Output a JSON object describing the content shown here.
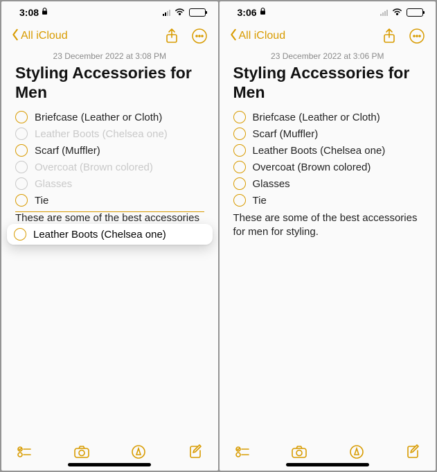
{
  "accent": "#d89b00",
  "left": {
    "status": {
      "time": "3:08",
      "lock": "🔒"
    },
    "nav": {
      "back_label": "All iCloud"
    },
    "date": "23 December 2022 at 3:08 PM",
    "title": "Styling Accessories for Men",
    "items": {
      "0": "Briefcase (Leather or Cloth)",
      "1": "Leather Boots (Chelsea one)",
      "2": "Scarf (Muffler)",
      "3": "Overcoat (Brown colored)",
      "4": "Glasses",
      "5": "Tie"
    },
    "drag_item": "Leather Boots (Chelsea one)",
    "body": "These are some of the best accessories for men for styling."
  },
  "right": {
    "status": {
      "time": "3:06",
      "lock": "🔒"
    },
    "nav": {
      "back_label": "All iCloud"
    },
    "date": "23 December 2022 at 3:06 PM",
    "title": "Styling Accessories for Men",
    "items": {
      "0": "Briefcase (Leather or Cloth)",
      "1": "Scarf (Muffler)",
      "2": "Leather Boots (Chelsea one)",
      "3": "Overcoat (Brown colored)",
      "4": "Glasses",
      "5": "Tie"
    },
    "body": "These are some of the best accessories for men for styling."
  }
}
